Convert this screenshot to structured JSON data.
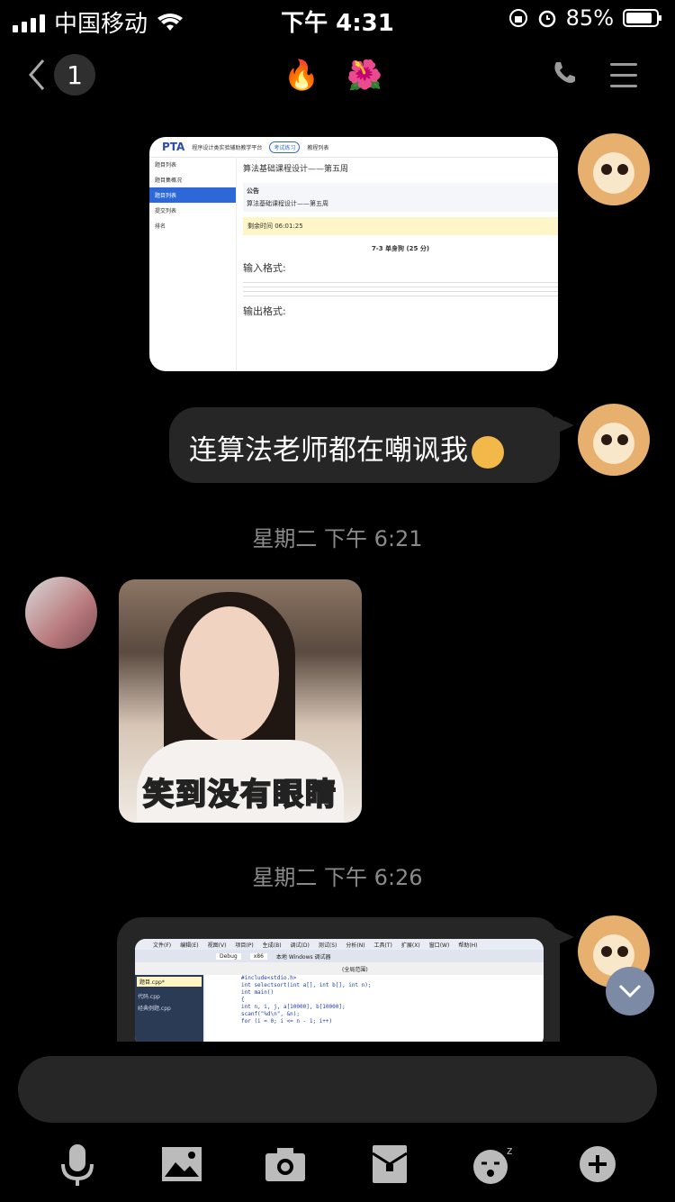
{
  "status_bar": {
    "carrier": "中国移动",
    "time": "下午 4:31",
    "battery": "85%"
  },
  "header": {
    "back_count": "1",
    "title": "🔥 🌺"
  },
  "messages": {
    "screenshot": {
      "brand": "PTA",
      "platform": "程序设计类实验辅助教学平台",
      "tab1": "考试练习",
      "tab2": "教程列表",
      "side": [
        "题目列表",
        "题目集概况",
        "题目列表",
        "提交列表",
        "排名"
      ],
      "course": "算法基础课程设计——第五周",
      "notice": "公告",
      "notice_text": "算法基础课程设计——第五周",
      "remaining": "剩余时间 06:01:25",
      "problem": "7-3 单身狗 (25 分)",
      "input_title": "输入格式:",
      "output_title": "输出格式:"
    },
    "text1": "连算法老师都在嘲讽我",
    "time1": "星期二 下午 6:21",
    "photo_caption": "笑到没有眼睛",
    "time2": "星期二 下午 6:26",
    "code": {
      "menu": [
        "文件(F)",
        "编辑(E)",
        "视图(V)",
        "项目(P)",
        "生成(B)",
        "调试(D)",
        "测试(S)",
        "分析(N)",
        "工具(T)",
        "扩展(X)",
        "窗口(W)",
        "帮助(H)"
      ],
      "debug": "Debug",
      "platform": "x86",
      "run": "本地 Windows 调试器",
      "scope": "(全局范围)",
      "file_tab": "题目.cpp*",
      "side_files": [
        "代码.cpp",
        "经典例题.cpp"
      ],
      "lines": [
        "#include<stdio.h>",
        "int selectsort(int a[], int b[], int n);",
        "int main()",
        "{",
        "  int n, i, j, a[10000], b[10000];",
        "  scanf(\"%d\\n\", &n);",
        "  for (i = 0; i <= n - 1; i++)"
      ]
    }
  },
  "toolbar": {
    "icons": [
      "mic-icon",
      "image-icon",
      "camera-icon",
      "red-packet-icon",
      "emoji-icon",
      "plus-icon"
    ]
  }
}
